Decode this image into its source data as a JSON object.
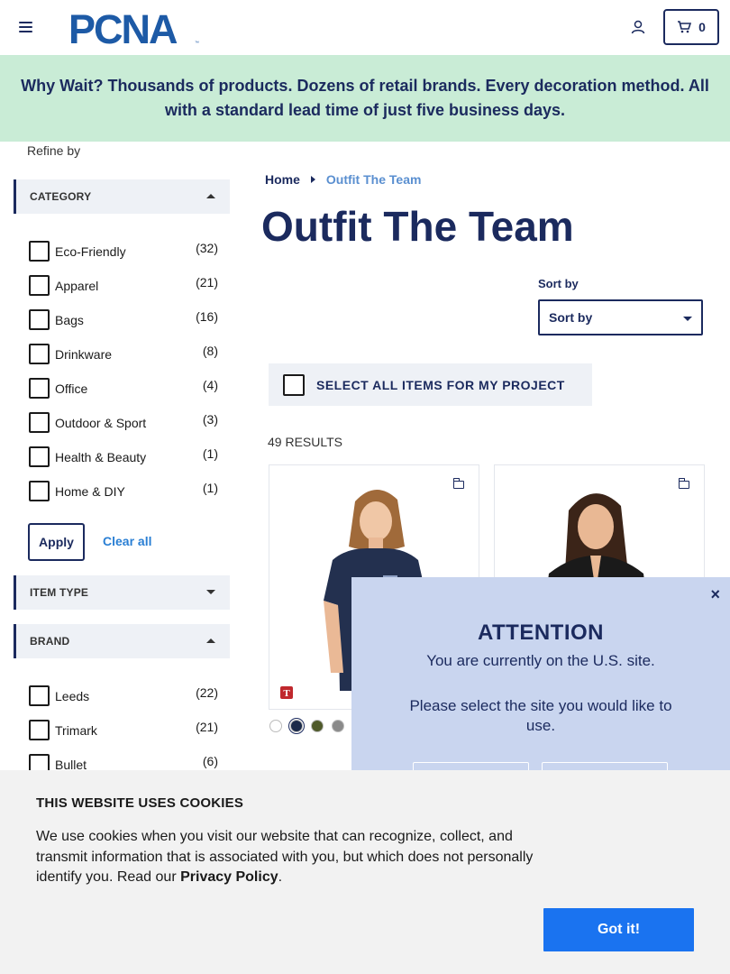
{
  "header": {
    "logo_text": "PCNA",
    "cart_count": "0"
  },
  "banner": {
    "text": "Why Wait? Thousands of products. Dozens of retail brands. Every decoration method. All with a standard lead time of just five business days."
  },
  "sidebar": {
    "refine_label": "Refine by",
    "category": {
      "title": "CATEGORY",
      "items": [
        {
          "label": "Eco-Friendly",
          "count": "(32)"
        },
        {
          "label": "Apparel",
          "count": "(21)"
        },
        {
          "label": "Bags",
          "count": "(16)"
        },
        {
          "label": "Drinkware",
          "count": "(8)"
        },
        {
          "label": "Office",
          "count": "(4)"
        },
        {
          "label": "Outdoor & Sport",
          "count": "(3)"
        },
        {
          "label": "Health & Beauty",
          "count": "(1)"
        },
        {
          "label": "Home & DIY",
          "count": "(1)"
        }
      ]
    },
    "apply_label": "Apply",
    "clear_label": "Clear all",
    "item_type": {
      "title": "ITEM TYPE"
    },
    "brand": {
      "title": "BRAND",
      "items": [
        {
          "label": "Leeds",
          "count": "(22)"
        },
        {
          "label": "Trimark",
          "count": "(21)"
        },
        {
          "label": "Bullet",
          "count": "(6)"
        }
      ]
    }
  },
  "main": {
    "breadcrumb": {
      "home": "Home",
      "current": "Outfit The Team"
    },
    "title": "Outfit The Team",
    "sort_label": "Sort by",
    "sort_value": "Sort by",
    "select_all_label": "SELECT ALL ITEMS FOR MY PROJECT",
    "results": "49 RESULTS",
    "swatches": [
      "#ffffff",
      "#1b2a4a",
      "#4f5a2a",
      "#8a8a8a"
    ]
  },
  "modal": {
    "title": "ATTENTION",
    "line1": "You are currently on the U.S. site.",
    "line2": "Please select the site you would like to use.",
    "close": "×"
  },
  "cookie": {
    "title": "THIS WEBSITE USES COOKIES",
    "message": "We use cookies when you visit our website that can recognize, collect, and transmit information that is associated with you, but which does not personally identify you. Read our ",
    "policy_link": "Privacy Policy",
    "period": ".",
    "button": "Got it!"
  },
  "colors": {
    "brand_navy": "#1b2a5e",
    "banner_bg": "#c9ecd6",
    "modal_bg": "#c9d5ef",
    "accent_blue": "#1a73f0"
  }
}
